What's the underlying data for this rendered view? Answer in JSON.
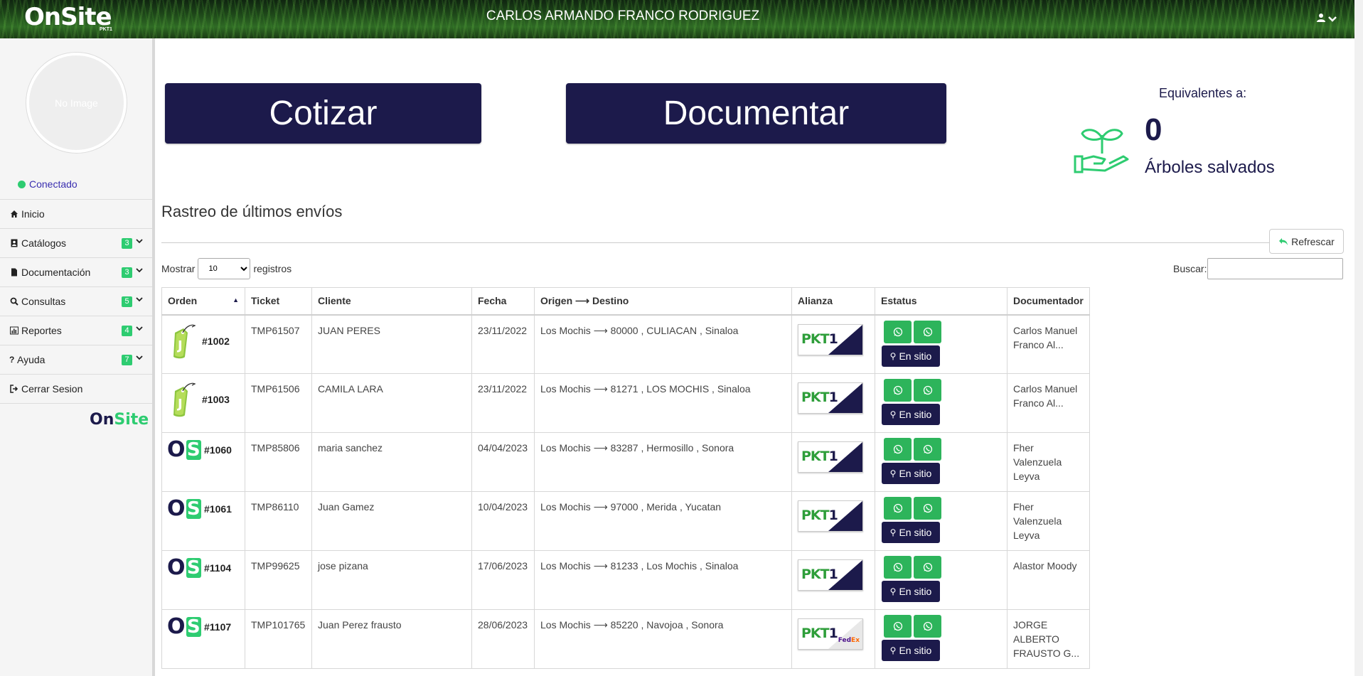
{
  "header": {
    "logo": "OnSite",
    "logo_sub": "PKT1",
    "user_name": "CARLOS ARMANDO FRANCO RODRIGUEZ",
    "user_menu_icon": "user-icon"
  },
  "sidebar": {
    "avatar_text": "No Image",
    "status": "Conectado",
    "items": [
      {
        "label": "Inicio",
        "icon": "home-icon",
        "badge": null
      },
      {
        "label": "Catálogos",
        "icon": "address-book-icon",
        "badge": "3"
      },
      {
        "label": "Documentación",
        "icon": "file-icon",
        "badge": "3"
      },
      {
        "label": "Consultas",
        "icon": "search-icon",
        "badge": "5"
      },
      {
        "label": "Reportes",
        "icon": "bar-chart-icon",
        "badge": "4"
      },
      {
        "label": "Ayuda",
        "icon": "question-icon",
        "badge": "7"
      },
      {
        "label": "Cerrar Sesion",
        "icon": "sign-out-icon",
        "badge": null
      }
    ],
    "footer_logo_a": "On",
    "footer_logo_b": "Site"
  },
  "actions": {
    "cotizar": "Cotizar",
    "documentar": "Documentar"
  },
  "equivalents": {
    "title": "Equivalentes a:",
    "count": "0",
    "label": "Árboles salvados"
  },
  "tracking": {
    "title": "Rastreo de últimos envíos",
    "refresh": "Refrescar",
    "show_label": "Mostrar",
    "page_size": "10",
    "records_label": "registros",
    "search_label": "Buscar:",
    "columns": [
      "Orden",
      "Ticket",
      "Cliente",
      "Fecha",
      "Origen ⟶ Destino",
      "Alianza",
      "Estatus",
      "Documentador"
    ],
    "rows": [
      {
        "order": "#1002",
        "order_icon": "tag",
        "ticket": "TMP61507",
        "client": "JUAN PERES",
        "date": "23/11/2022",
        "route": "Los Mochis ⟶ 80000 , CULIACAN , Sinaloa",
        "alliance": "PKT1",
        "status": "En sitio",
        "documenter": "Carlos Manuel Franco Al..."
      },
      {
        "order": "#1003",
        "order_icon": "tag",
        "ticket": "TMP61506",
        "client": "CAMILA LARA",
        "date": "23/11/2022",
        "route": "Los Mochis ⟶ 81271 , LOS MOCHIS , Sinaloa",
        "alliance": "PKT1",
        "status": "En sitio",
        "documenter": "Carlos Manuel Franco Al..."
      },
      {
        "order": "#1060",
        "order_icon": "os",
        "ticket": "TMP85806",
        "client": "maria sanchez",
        "date": "04/04/2023",
        "route": "Los Mochis ⟶ 83287 , Hermosillo , Sonora",
        "alliance": "PKT1",
        "status": "En sitio",
        "documenter": "Fher Valenzuela Leyva"
      },
      {
        "order": "#1061",
        "order_icon": "os",
        "ticket": "TMP86110",
        "client": "Juan Gamez",
        "date": "10/04/2023",
        "route": "Los Mochis ⟶ 97000 , Merida , Yucatan",
        "alliance": "PKT1",
        "status": "En sitio",
        "documenter": "Fher Valenzuela Leyva"
      },
      {
        "order": "#1104",
        "order_icon": "os",
        "ticket": "TMP99625",
        "client": "jose pizana",
        "date": "17/06/2023",
        "route": "Los Mochis ⟶ 81233 , Los Mochis , Sinaloa",
        "alliance": "PKT1",
        "status": "En sitio",
        "documenter": "Alastor Moody"
      },
      {
        "order": "#1107",
        "order_icon": "os",
        "ticket": "TMP101765",
        "client": "Juan Perez frausto",
        "date": "28/06/2023",
        "route": "Los Mochis ⟶ 85220 , Navojoa , Sonora",
        "alliance": "PKT1 FedEx",
        "status": "En sitio",
        "documenter": "JORGE ALBERTO FRAUSTO G..."
      }
    ]
  }
}
